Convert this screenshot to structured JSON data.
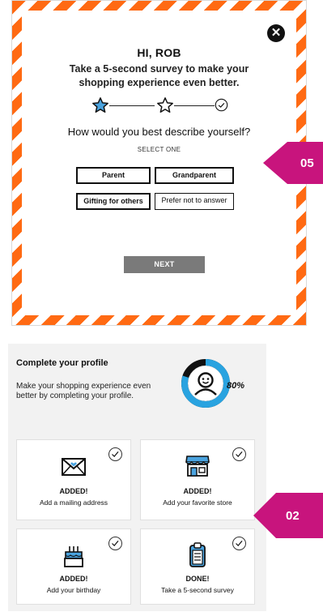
{
  "survey": {
    "greeting": "HI, ROB",
    "intro": "Take a 5-second survey to make your shopping experience even better.",
    "question": "How would you best describe yourself?",
    "instruction": "SELECT ONE",
    "options": [
      "Parent",
      "Grandparent",
      "Gifting for others",
      "Prefer not to answer"
    ],
    "next_label": "NEXT",
    "step_current": 1,
    "step_total": 3
  },
  "badges": {
    "survey_step": "05",
    "profile_step": "02"
  },
  "profile": {
    "title": "Complete your profile",
    "description": "Make your shopping experience even better by completing your profile.",
    "completion": "80%",
    "completion_value": 0.8,
    "tiles": [
      {
        "status": "ADDED!",
        "caption": "Add a mailing address",
        "icon": "envelope-heart-icon"
      },
      {
        "status": "ADDED!",
        "caption": "Add your favorite store",
        "icon": "store-icon"
      },
      {
        "status": "ADDED!",
        "caption": "Add your birthday",
        "icon": "birthday-cake-icon"
      },
      {
        "status": "DONE!",
        "caption": "Take a 5-second survey",
        "icon": "clipboard-icon"
      }
    ]
  },
  "colors": {
    "stripe_orange": "#ff6a13",
    "badge_magenta": "#c8147d",
    "gauge_blue": "#29a3e0",
    "star_blue": "#4aa3df",
    "next_gray": "#7a7a7a"
  }
}
